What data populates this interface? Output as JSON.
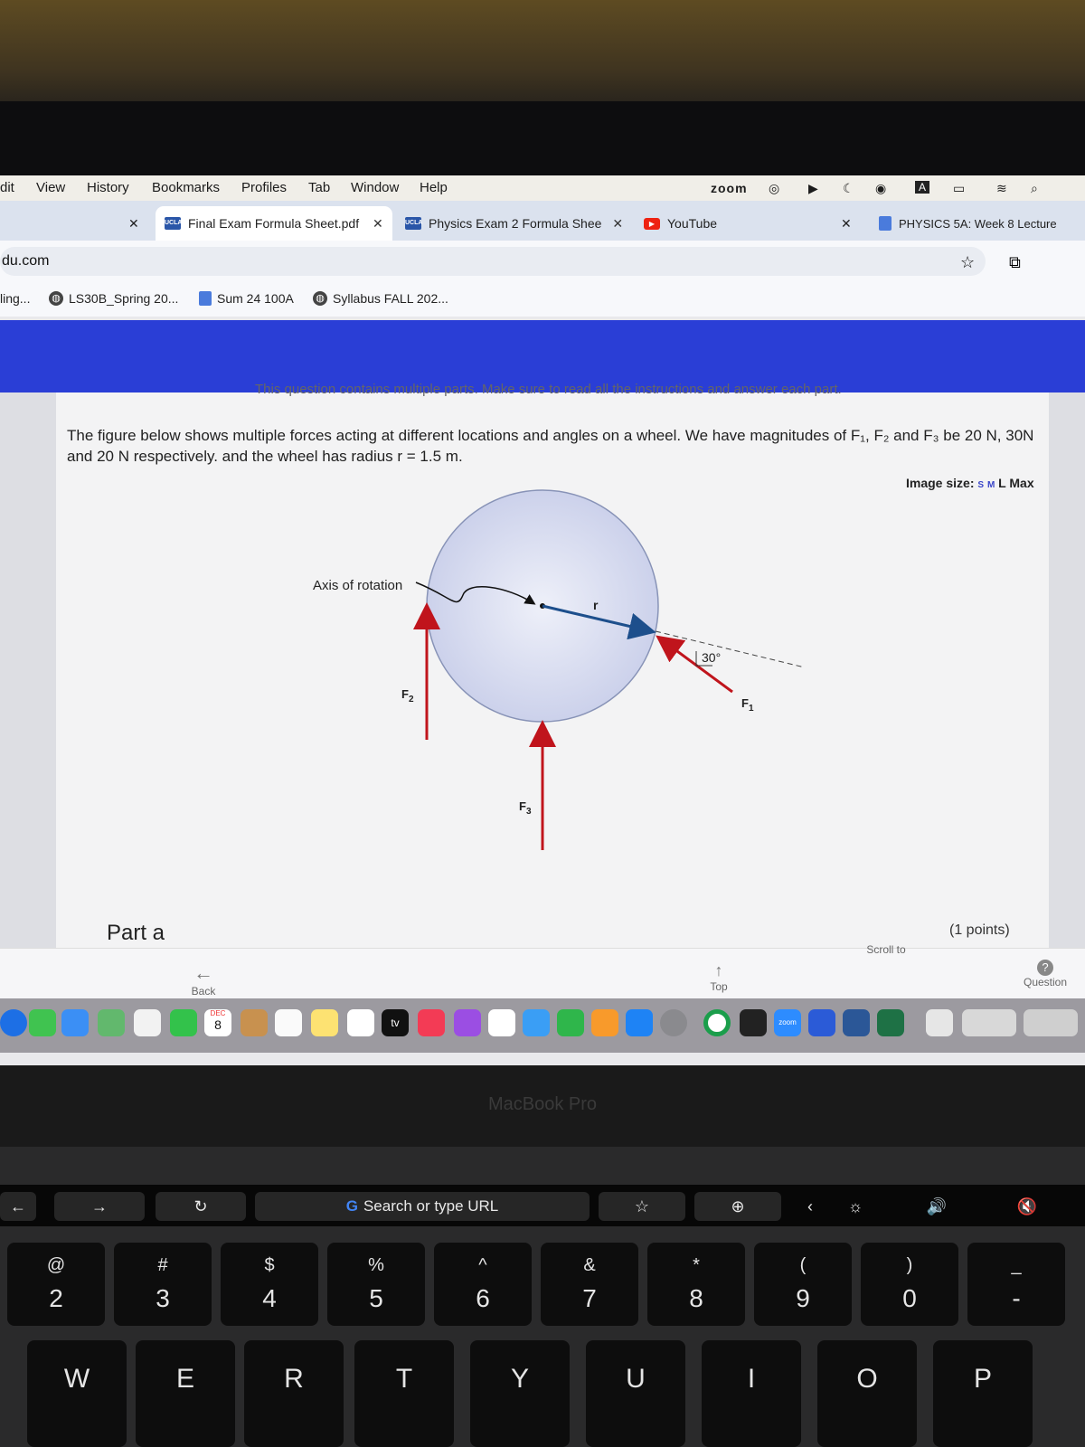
{
  "menubar": {
    "items": [
      "dit",
      "View",
      "History",
      "Bookmarks",
      "Profiles",
      "Tab",
      "Window",
      "Help"
    ],
    "zoom_label": "zoom"
  },
  "tabs": [
    {
      "label": "Final Exam Formula Sheet.pdf",
      "fav": "UCLA"
    },
    {
      "label": "Physics Exam 2 Formula Shee",
      "fav": "UCLA"
    },
    {
      "label": "YouTube"
    },
    {
      "label": "PHYSICS 5A: Week 8 Lecture"
    }
  ],
  "address": {
    "url": "du.com"
  },
  "bookmarks": [
    "ling...",
    "LS30B_Spring 20...",
    "Sum 24 100A",
    "Syllabus FALL 202..."
  ],
  "page": {
    "clipped_instruction": "This question contains multiple parts. Make sure to read all the instructions and answer each part.",
    "question": "The figure below shows multiple forces acting at different locations and angles on a wheel. We have magnitudes of F₁, F₂ and F₃ be 20 N, 30N and 20 N respectively. and the wheel has radius r = 1.5 m.",
    "image_size_label": "Image size:",
    "image_size_options": [
      "S",
      "M",
      "L",
      "Max"
    ],
    "part_label": "Part a",
    "points_label": "(1 points)",
    "scroll_label": "Scroll to",
    "nav_back": "Back",
    "nav_top": "Top",
    "nav_question": "Question"
  },
  "figure": {
    "axis_label": "Axis of rotation",
    "r_label": "r",
    "f1_label": "F",
    "f1_sub": "1",
    "f2_label": "F",
    "f2_sub": "2",
    "f3_label": "F",
    "f3_sub": "3",
    "angle_label": "30°"
  },
  "dock": {
    "calendar_month": "DEC",
    "calendar_day": "8",
    "tv_label": "tv",
    "zoom_label": "zoom"
  },
  "laptop": {
    "brand_label": "MacBook Pro"
  },
  "touchbar": {
    "search_placeholder": "Search or type URL"
  },
  "keys": [
    {
      "top": "@",
      "bottom": "2"
    },
    {
      "top": "#",
      "bottom": "3"
    },
    {
      "top": "$",
      "bottom": "4"
    },
    {
      "top": "%",
      "bottom": "5"
    },
    {
      "top": "^",
      "bottom": "6"
    },
    {
      "top": "&",
      "bottom": "7"
    },
    {
      "top": "*",
      "bottom": "8"
    },
    {
      "top": "(",
      "bottom": "9"
    },
    {
      "top": ")",
      "bottom": "0"
    },
    {
      "top": "_",
      "bottom": "-"
    }
  ],
  "letters": [
    "W",
    "E",
    "R",
    "T",
    "Y",
    "U",
    "I",
    "O",
    "P"
  ]
}
